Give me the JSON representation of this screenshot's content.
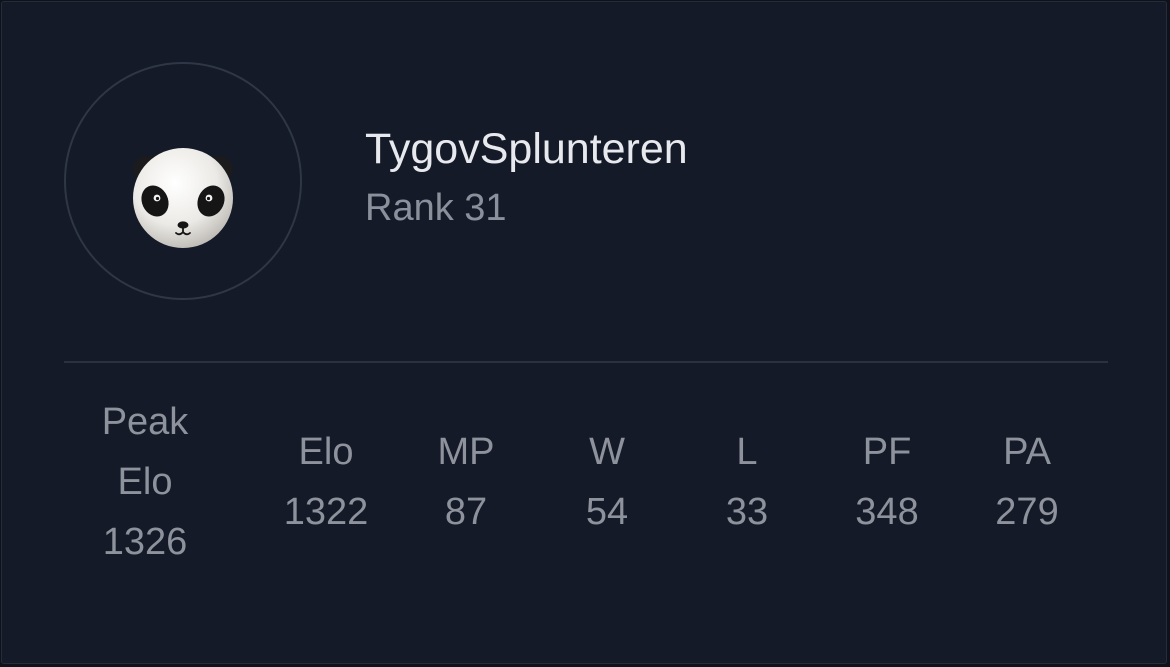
{
  "profile": {
    "username": "TygovSplunteren",
    "rank": "Rank 31",
    "avatar_icon": "panda-icon"
  },
  "stats": {
    "peak": {
      "line1": "Peak",
      "line2": "Elo",
      "value": "1326"
    },
    "elo": {
      "label": "Elo",
      "value": "1322"
    },
    "mp": {
      "label": "MP",
      "value": "87"
    },
    "w": {
      "label": "W",
      "value": "54"
    },
    "l": {
      "label": "L",
      "value": "33"
    },
    "pf": {
      "label": "PF",
      "value": "348"
    },
    "pa": {
      "label": "PA",
      "value": "279"
    }
  },
  "colors": {
    "card_bg": "#141a27",
    "name_text": "#e7e9ee",
    "muted_text": "#8d929c",
    "divider": "#2b313d"
  }
}
